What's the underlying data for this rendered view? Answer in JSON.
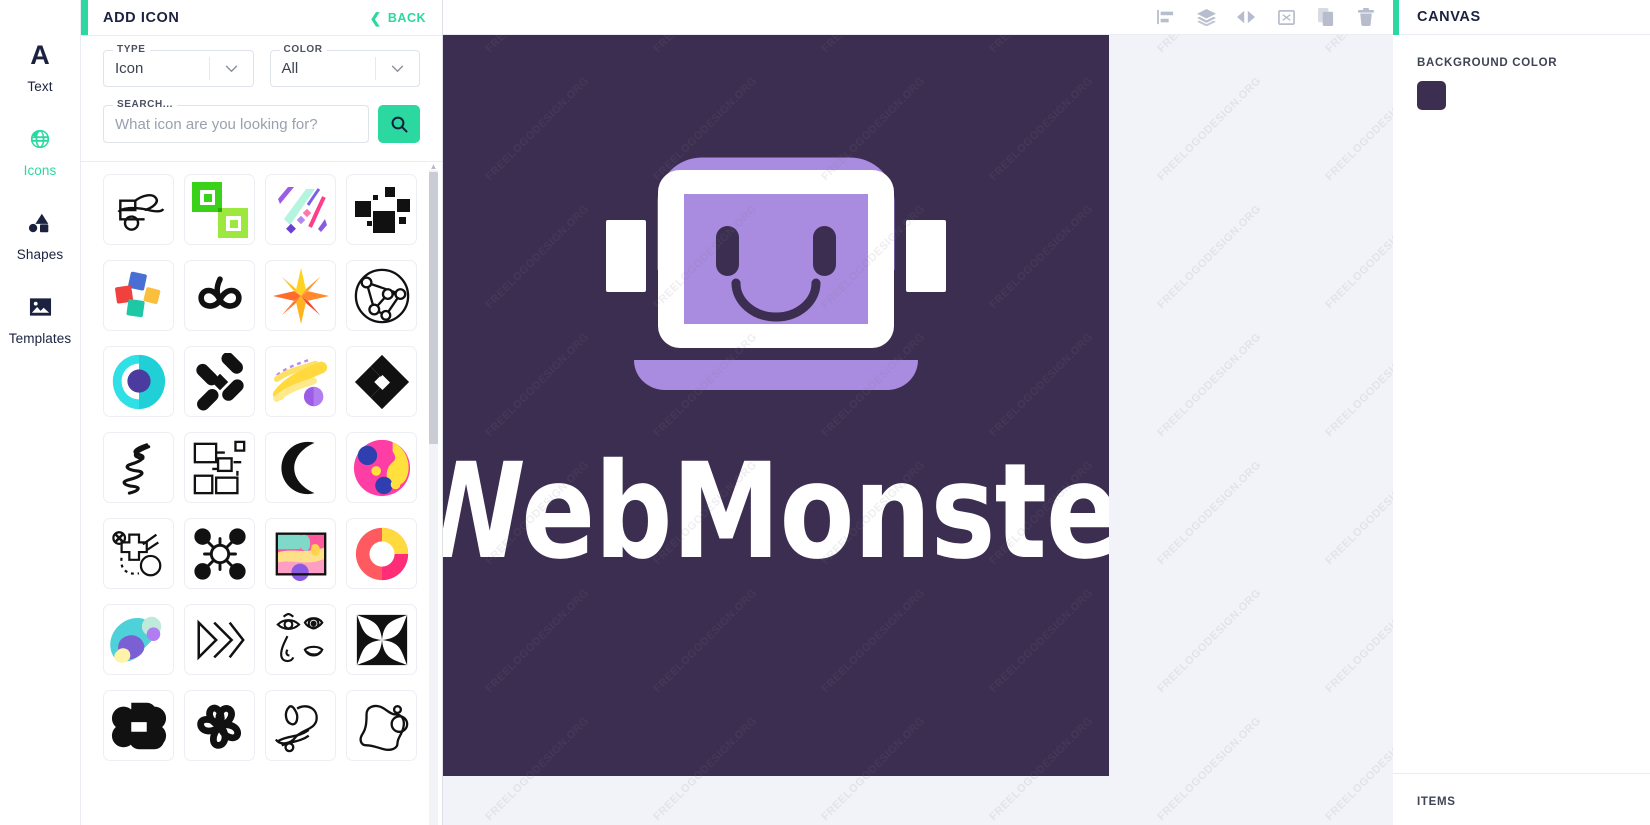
{
  "left_rail": {
    "items": [
      {
        "label": "Text",
        "icon": "text-a-icon",
        "active": false
      },
      {
        "label": "Icons",
        "icon": "globe-icon",
        "active": true
      },
      {
        "label": "Shapes",
        "icon": "shapes-icon",
        "active": false
      },
      {
        "label": "Templates",
        "icon": "image-icon",
        "active": false
      }
    ]
  },
  "icon_panel": {
    "title": "ADD ICON",
    "back_label": "BACK",
    "type_filter": {
      "legend": "TYPE",
      "value": "Icon"
    },
    "color_filter": {
      "legend": "COLOR",
      "value": "All"
    },
    "search": {
      "legend": "SEARCH...",
      "placeholder": "What icon are you looking for?",
      "value": "",
      "button_icon": "search-icon"
    },
    "results": [
      {
        "name": "airplane-outline-icon"
      },
      {
        "name": "green-squares-icon"
      },
      {
        "name": "pastel-diagonal-strokes-icon"
      },
      {
        "name": "black-pixel-blocks-icon"
      },
      {
        "name": "colorful-puzzle-pieces-icon"
      },
      {
        "name": "sprout-leaves-icon"
      },
      {
        "name": "orange-eight-point-star-icon"
      },
      {
        "name": "network-nodes-circle-icon"
      },
      {
        "name": "teal-location-pin-icon"
      },
      {
        "name": "black-pinwheel-diamond-icon"
      },
      {
        "name": "yellow-brushstroke-icon"
      },
      {
        "name": "black-nested-diamonds-icon"
      },
      {
        "name": "black-scribble-icon"
      },
      {
        "name": "outline-squares-maze-icon"
      },
      {
        "name": "black-crescent-moon-icon"
      },
      {
        "name": "colorful-abstract-circle-icon"
      },
      {
        "name": "cross-circle-sketch-icon"
      },
      {
        "name": "molecule-nodes-icon"
      },
      {
        "name": "pastel-landscape-abstract-icon"
      },
      {
        "name": "pink-yellow-donut-icon"
      },
      {
        "name": "teal-purple-blob-icon"
      },
      {
        "name": "fast-forward-arrows-icon"
      },
      {
        "name": "face-features-outline-icon"
      },
      {
        "name": "black-concave-square-icon"
      },
      {
        "name": "interlocking-cross-icon"
      },
      {
        "name": "five-petal-flower-icon"
      },
      {
        "name": "wavy-line-art-icon"
      },
      {
        "name": "abstract-blob-outline-icon"
      }
    ],
    "scrollbar": {
      "name": "icon-grid-scrollbar"
    }
  },
  "stage": {
    "toolbar": [
      {
        "name": "align-icon",
        "label": "Align"
      },
      {
        "name": "layers-icon",
        "label": "Layers"
      },
      {
        "name": "flip-horizontal-icon",
        "label": "Flip"
      },
      {
        "name": "resize-frame-icon",
        "label": "Resize"
      },
      {
        "name": "duplicate-icon",
        "label": "Duplicate"
      },
      {
        "name": "trash-icon",
        "label": "Delete"
      }
    ],
    "watermark_text": "FREELOGODESIGN.ORG",
    "logo": {
      "wordmark": "WebMonster",
      "background_color": "#3C2E50",
      "accent_color": "#A98BE0",
      "light_color": "#FFFFFF",
      "mark_name": "robot-laptop-headphones-mark"
    }
  },
  "right_panel": {
    "title": "CANVAS",
    "background_color_label": "BACKGROUND COLOR",
    "background_color_value": "#3C2E50",
    "items_label": "ITEMS"
  }
}
